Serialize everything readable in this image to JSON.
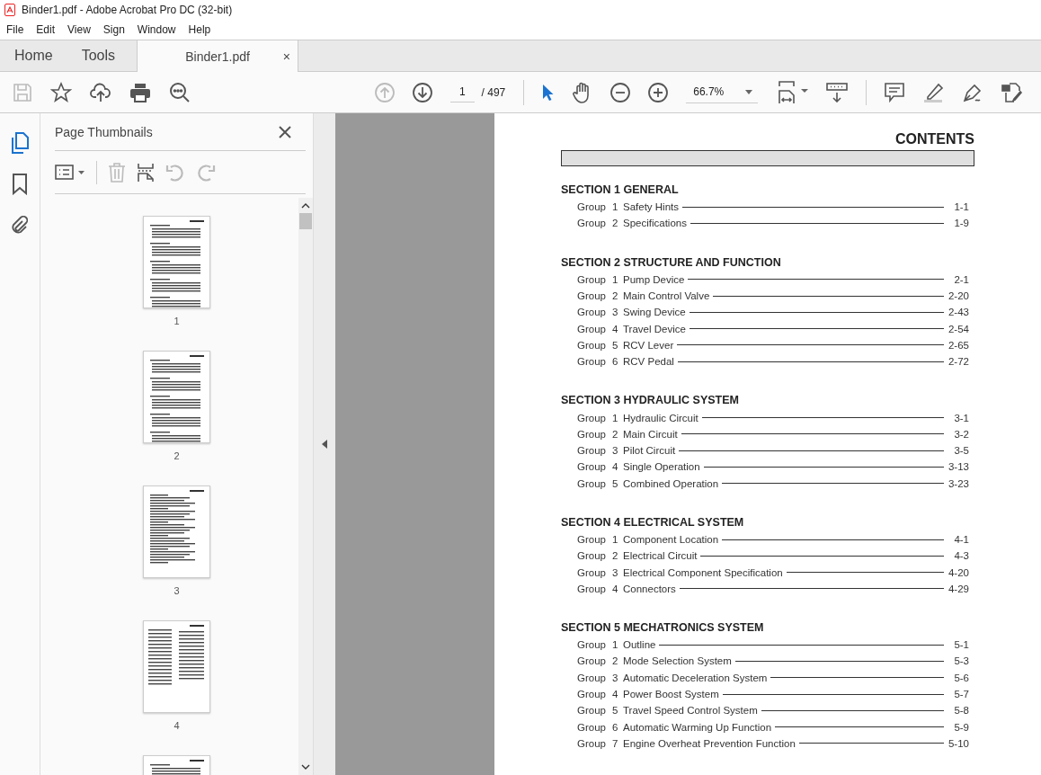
{
  "window": {
    "title": "Binder1.pdf - Adobe Acrobat Pro DC (32-bit)"
  },
  "menu": [
    "File",
    "Edit",
    "View",
    "Sign",
    "Window",
    "Help"
  ],
  "tabs": [
    {
      "label": "Home",
      "selected": false
    },
    {
      "label": "Tools",
      "selected": false
    },
    {
      "label": "Binder1.pdf",
      "selected": true,
      "close": "×"
    }
  ],
  "toolbar": {
    "page": "1",
    "page_total": "/ 497",
    "zoom": "66.7%"
  },
  "rail": [
    {
      "kind": "pages",
      "selected": true
    },
    {
      "kind": "bookmark",
      "selected": false
    },
    {
      "kind": "attachment",
      "selected": false
    }
  ],
  "panel": {
    "title": "Page Thumbnails",
    "thumbnails": [
      {
        "label": "1",
        "kind": "toc"
      },
      {
        "label": "2",
        "kind": "toc"
      },
      {
        "label": "3",
        "kind": "text"
      },
      {
        "label": "4",
        "kind": "table"
      },
      {
        "kind": "toc"
      }
    ]
  },
  "document": {
    "heading": "CONTENTS",
    "sections": [
      {
        "title": "SECTION 1  GENERAL",
        "groups": [
          {
            "label": "Group",
            "number": "1",
            "title": "Safety Hints",
            "page": "1-1"
          },
          {
            "label": "Group",
            "number": "2",
            "title": "Specifications",
            "page": "1-9"
          }
        ]
      },
      {
        "title": "SECTION 2  STRUCTURE AND FUNCTION",
        "groups": [
          {
            "label": "Group",
            "number": "1",
            "title": "Pump Device",
            "page": "2-1"
          },
          {
            "label": "Group",
            "number": "2",
            "title": "Main Control Valve",
            "page": "2-20"
          },
          {
            "label": "Group",
            "number": "3",
            "title": "Swing Device",
            "page": "2-43"
          },
          {
            "label": "Group",
            "number": "4",
            "title": "Travel Device",
            "page": "2-54"
          },
          {
            "label": "Group",
            "number": "5",
            "title": "RCV Lever",
            "page": "2-65"
          },
          {
            "label": "Group",
            "number": "6",
            "title": "RCV Pedal",
            "page": "2-72"
          }
        ]
      },
      {
        "title": "SECTION 3  HYDRAULIC SYSTEM",
        "groups": [
          {
            "label": "Group",
            "number": "1",
            "title": "Hydraulic Circuit",
            "page": "3-1"
          },
          {
            "label": "Group",
            "number": "2",
            "title": "Main Circuit",
            "page": "3-2"
          },
          {
            "label": "Group",
            "number": "3",
            "title": "Pilot Circuit",
            "page": "3-5"
          },
          {
            "label": "Group",
            "number": "4",
            "title": "Single Operation",
            "page": "3-13"
          },
          {
            "label": "Group",
            "number": "5",
            "title": "Combined Operation",
            "page": "3-23"
          }
        ]
      },
      {
        "title": "SECTION 4  ELECTRICAL SYSTEM",
        "groups": [
          {
            "label": "Group",
            "number": "1",
            "title": "Component Location",
            "page": "4-1"
          },
          {
            "label": "Group",
            "number": "2",
            "title": "Electrical Circuit",
            "page": "4-3"
          },
          {
            "label": "Group",
            "number": "3",
            "title": "Electrical Component Specification",
            "page": "4-20"
          },
          {
            "label": "Group",
            "number": "4",
            "title": "Connectors",
            "page": "4-29"
          }
        ]
      },
      {
        "title": "SECTION 5  MECHATRONICS SYSTEM",
        "groups": [
          {
            "label": "Group",
            "number": "1",
            "title": "Outline",
            "page": "5-1"
          },
          {
            "label": "Group",
            "number": "2",
            "title": "Mode Selection System",
            "page": "5-3"
          },
          {
            "label": "Group",
            "number": "3",
            "title": "Automatic Deceleration System",
            "page": "5-6"
          },
          {
            "label": "Group",
            "number": "4",
            "title": "Power Boost System",
            "page": "5-7"
          },
          {
            "label": "Group",
            "number": "5",
            "title": "Travel Speed Control System",
            "page": "5-8"
          },
          {
            "label": "Group",
            "number": "6",
            "title": "Automatic Warming Up Function",
            "page": "5-9"
          },
          {
            "label": "Group",
            "number": "7",
            "title": "Engine Overheat Prevention Function",
            "page": "5-10"
          }
        ]
      }
    ]
  }
}
